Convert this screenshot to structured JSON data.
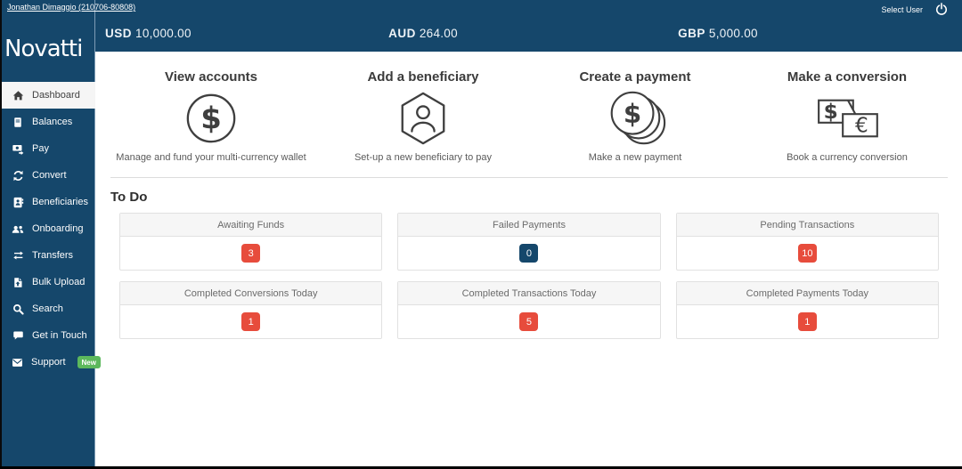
{
  "topbar": {
    "user_link": "Jonathan Dimaggio (210706-80808)",
    "select_user_label": "Select User",
    "power_icon": "power-icon",
    "currencies": [
      {
        "code": "USD",
        "amount": "10,000.00"
      },
      {
        "code": "AUD",
        "amount": "264.00"
      },
      {
        "code": "GBP",
        "amount": "5,000.00"
      }
    ]
  },
  "sidebar": {
    "logo_text": "Novatti",
    "items": [
      {
        "label": "Dashboard",
        "icon": "home-icon",
        "active": true
      },
      {
        "label": "Balances",
        "icon": "ledger-book-icon",
        "active": false
      },
      {
        "label": "Pay",
        "icon": "money-send-icon",
        "active": false
      },
      {
        "label": "Convert",
        "icon": "sync-arrows-icon",
        "active": false
      },
      {
        "label": "Beneficiaries",
        "icon": "address-book-icon",
        "active": false
      },
      {
        "label": "Onboarding",
        "icon": "users-icon",
        "active": false
      },
      {
        "label": "Transfers",
        "icon": "exchange-arrows-icon",
        "active": false
      },
      {
        "label": "Bulk Upload",
        "icon": "file-upload-icon",
        "active": false
      },
      {
        "label": "Search",
        "icon": "search-icon",
        "active": false
      },
      {
        "label": "Get in Touch",
        "icon": "chat-bubble-icon",
        "active": false
      },
      {
        "label": "Support",
        "icon": "envelope-icon",
        "active": false,
        "badge": "New"
      }
    ]
  },
  "actions": [
    {
      "title": "View accounts",
      "icon": "dollar-circle-icon",
      "description": "Manage and fund your multi-currency wallet"
    },
    {
      "title": "Add a beneficiary",
      "icon": "beneficiary-hexagon-icon",
      "description": "Set-up a new beneficiary to pay"
    },
    {
      "title": "Create a payment",
      "icon": "coins-icon",
      "description": "Make a new payment"
    },
    {
      "title": "Make a conversion",
      "icon": "currency-exchange-icon",
      "description": "Book a currency conversion"
    }
  ],
  "todo": {
    "heading": "To Do",
    "cards": [
      {
        "title": "Awaiting Funds",
        "count": "3",
        "badge_color": "#e74c3c"
      },
      {
        "title": "Failed Payments",
        "count": "0",
        "badge_color": "#15476b"
      },
      {
        "title": "Pending Transactions",
        "count": "10",
        "badge_color": "#e74c3c"
      },
      {
        "title": "Completed Conversions Today",
        "count": "1",
        "badge_color": "#e74c3c"
      },
      {
        "title": "Completed Transactions Today",
        "count": "5",
        "badge_color": "#e74c3c"
      },
      {
        "title": "Completed Payments Today",
        "count": "1",
        "badge_color": "#e74c3c"
      }
    ]
  },
  "colors": {
    "navy": "#15476b",
    "red": "#e74c3c",
    "green": "#5cb85c",
    "white_line": "#ffffff"
  }
}
